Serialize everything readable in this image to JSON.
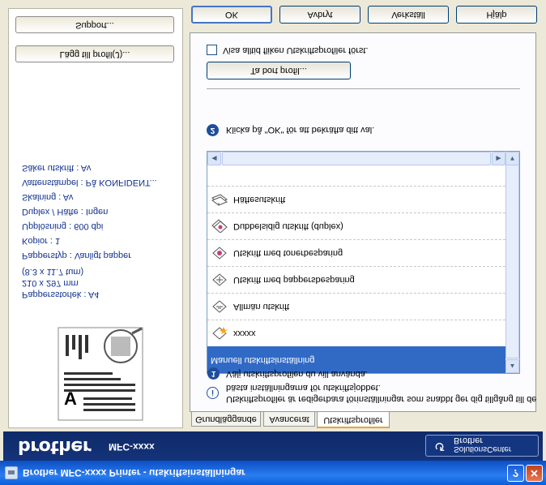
{
  "window": {
    "title": "Brother MFC-xxxx Printer - utskriftsinställningar",
    "help_glyph": "?",
    "close_glyph": "✕"
  },
  "banner": {
    "logo": "brother",
    "model": "MFC-xxxx",
    "solutions_line1": "SolutionsCenter",
    "solutions_line2": "Brother"
  },
  "preview": {
    "info_lines": [
      "Pappersstorlek : A4",
      "210 x 297 mm",
      "(8.3 x 11.7 tum)",
      "Papperstyp : Vanligt papper",
      "Kopior : 1",
      "Upplösning : 600 dpi",
      "Duplex / Häfte : Ingen",
      "Skalning : Av",
      "Vattenstämpel : På KONFIDENT...",
      "Säker utskrift : Av"
    ],
    "add_profile_button": "Lägg till profil(J)...",
    "support_button": "Support..."
  },
  "tabs": [
    {
      "label": "Grundläggande"
    },
    {
      "label": "Avancerat"
    },
    {
      "label": "Utskriftsprofiler"
    }
  ],
  "profiles": {
    "info_text_line1": "Utskriftsprofiler är redigerbara förinställningar som snabbt ger dig tillgång till de",
    "info_text_line2": "bästa inställningarna för utskriftsjobbet.",
    "step1_text": "Välj utskriftsprofilen du vill använda.",
    "step2_text": "Klicka på \"OK\" för att bekräfta ditt val.",
    "step1_number": "1",
    "step2_number": "2",
    "info_glyph": "i",
    "items": [
      {
        "label": "Manuell utskriftsinställning",
        "icon": "manual-settings-icon"
      },
      {
        "label": "xxxxx",
        "icon": "custom-profile-icon"
      },
      {
        "label": "Allmän utskrift",
        "icon": "general-print-icon"
      },
      {
        "label": "Utskrift med pappersbesparing",
        "icon": "paper-saving-icon"
      },
      {
        "label": "Utskrift med tonerbesparing",
        "icon": "toner-saving-icon"
      },
      {
        "label": "Dubbelsidig utskrift (duplex)",
        "icon": "duplex-print-icon"
      },
      {
        "label": "Häftesutskrift",
        "icon": "booklet-print-icon"
      }
    ],
    "selected_index": 0,
    "delete_profile_button": "Ta bort profil...",
    "always_show_checkbox": "Visa alltid fliken Utskriftsprofiler först.",
    "always_show_checked": false
  },
  "buttons": {
    "ok": "OK",
    "cancel": "Avbryt",
    "apply": "Verkställ",
    "help": "Hjälp"
  },
  "colors": {
    "selection": "#316ac5",
    "banner": "#15337a",
    "info_text": "#11308c"
  }
}
